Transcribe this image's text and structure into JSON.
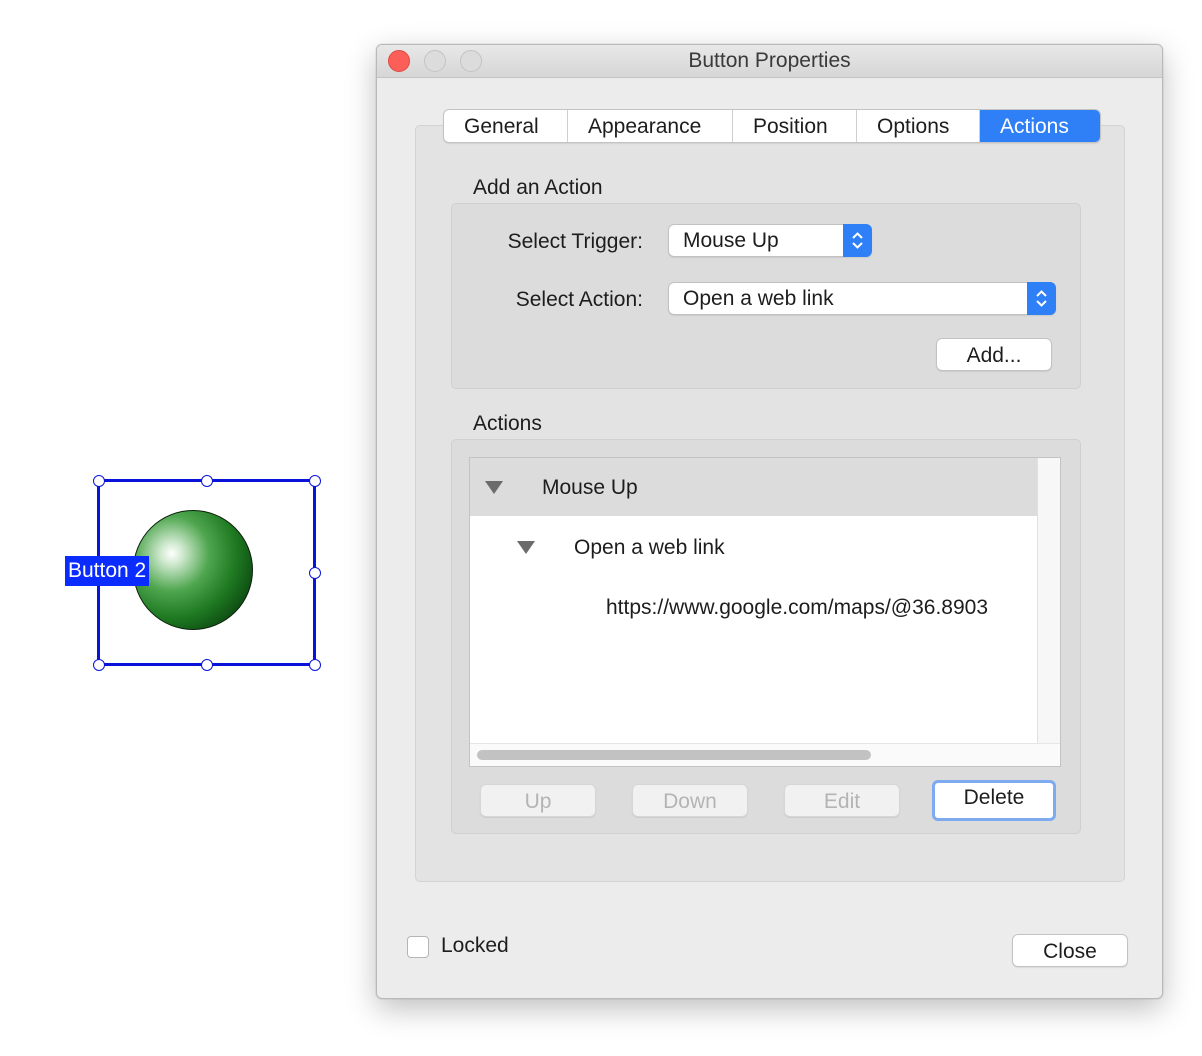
{
  "field": {
    "label": "Button 2"
  },
  "window": {
    "title": "Button Properties"
  },
  "tabs": [
    {
      "label": "General"
    },
    {
      "label": "Appearance"
    },
    {
      "label": "Position"
    },
    {
      "label": "Options"
    },
    {
      "label": "Actions"
    }
  ],
  "add_action": {
    "section_label": "Add an Action",
    "trigger_label": "Select Trigger:",
    "trigger_value": "Mouse Up",
    "action_label": "Select Action:",
    "action_value": "Open a web link",
    "add_button": "Add..."
  },
  "actions": {
    "section_label": "Actions",
    "trigger": "Mouse Up",
    "action": "Open a web link",
    "url": "https://www.google.com/maps/@36.8903"
  },
  "buttons": {
    "up": "Up",
    "down": "Down",
    "edit": "Edit",
    "delete": "Delete",
    "close": "Close"
  },
  "locked": {
    "label": "Locked",
    "checked": false
  },
  "colors": {
    "accent": "#2f7ff6",
    "selection": "#0a14d8",
    "close_light": "#fc5f57"
  }
}
